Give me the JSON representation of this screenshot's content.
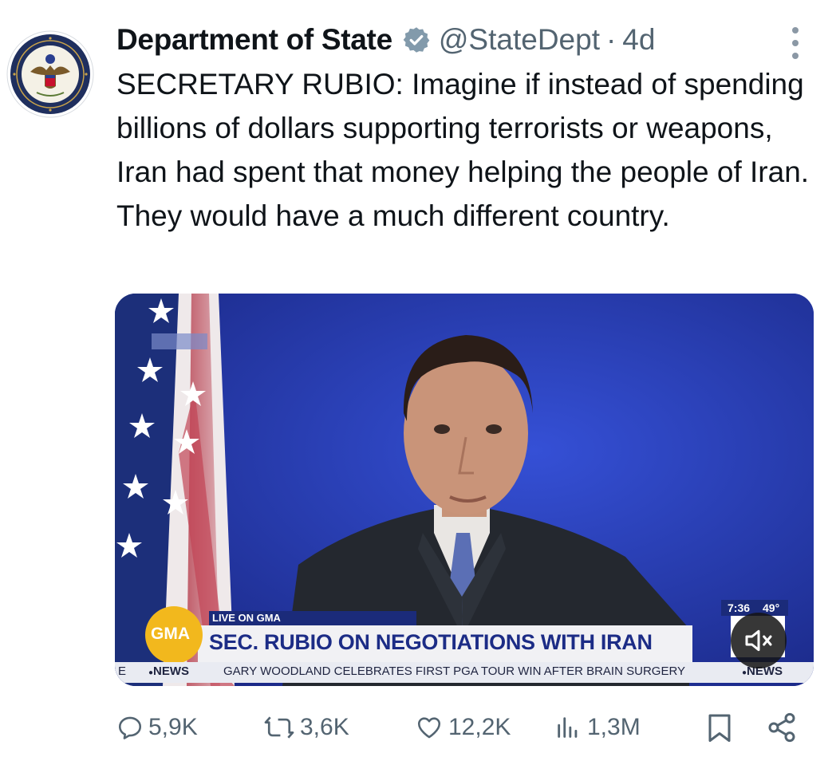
{
  "tweet": {
    "author_name": "Department of State",
    "handle": "@StateDept",
    "separator": "·",
    "time": "4d",
    "text": "SECRETARY RUBIO: Imagine if instead of spending billions of dollars supporting terrorists or weapons, Iran had spent that money helping the people of Iran. They would have a much different country."
  },
  "video": {
    "live_label": "LIVE ON GMA",
    "network_logo": "GMA",
    "headline": "SEC. RUBIO ON NEGOTIATIONS WITH IRAN",
    "ticker_prefix": "E",
    "ticker_brand": "NEWS",
    "ticker_text": "GARY WOODLAND CELEBRATES FIRST PGA TOUR WIN AFTER BRAIN SURGERY",
    "ticker_brand_right": "NEWS",
    "clock": "7:36",
    "temperature": "49°"
  },
  "actions": {
    "replies": "5,9K",
    "reposts": "3,6K",
    "likes": "12,2K",
    "views": "1,3M"
  },
  "colors": {
    "brand_blue": "#1d9bf0",
    "studio_blue": "#2536a8",
    "gma_yellow": "#f2b81d",
    "secondary_text": "#536471"
  },
  "icons": [
    "verified-badge-icon",
    "more-options-icon",
    "mute-icon",
    "reply-icon",
    "repost-icon",
    "like-icon",
    "views-icon",
    "bookmark-icon",
    "share-icon"
  ]
}
